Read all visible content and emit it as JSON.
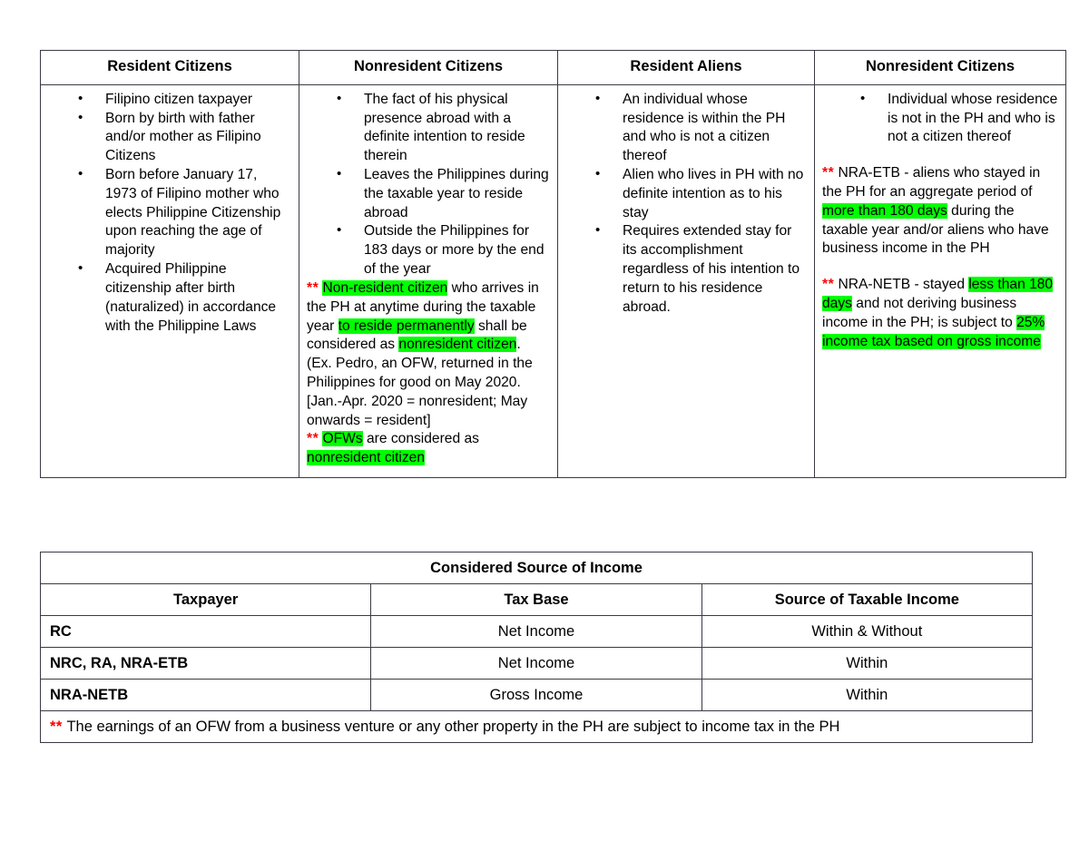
{
  "classification_table": {
    "columns": [
      {
        "header": "Resident Citizens",
        "bullets": [
          "Filipino citizen taxpayer",
          "Born by birth with father and/or mother as Filipino Citizens",
          "Born before January 17, 1973 of Filipino mother who elects Philippine Citizenship upon reaching the age of majority",
          "Acquired Philippine citizenship after birth (naturalized) in accordance with the Philippine Laws"
        ],
        "notes": []
      },
      {
        "header": "Nonresident Citizens",
        "bullets": [
          "The fact of his physical presence abroad with a definite intention to reside therein",
          "Leaves the Philippines during the taxable year to reside abroad",
          "Outside the Philippines for 183 days or more by the end of the year"
        ],
        "notes": [
          {
            "asterisk": "**",
            "segments": [
              {
                "text": "Non-resident citizen",
                "highlight": true
              },
              {
                "text": " who arrives in the PH at anytime during the taxable year ",
                "highlight": false
              },
              {
                "text": "to reside permanently",
                "highlight": true
              },
              {
                "text": " shall be considered as ",
                "highlight": false
              },
              {
                "text": "nonresident citizen",
                "highlight": true
              },
              {
                "text": ".",
                "highlight": false
              }
            ]
          },
          {
            "asterisk": "",
            "segments": [
              {
                "text": "(Ex. Pedro, an OFW, returned in the Philippines for good on May 2020. [Jan.-Apr. 2020 = nonresident; May onwards = resident]",
                "highlight": false
              }
            ]
          },
          {
            "asterisk": "**",
            "segments": [
              {
                "text": "OFWs",
                "highlight": true
              },
              {
                "text": " are considered as ",
                "highlight": false
              },
              {
                "text": "nonresident citizen",
                "highlight": true
              }
            ]
          }
        ]
      },
      {
        "header": "Resident Aliens",
        "bullets": [
          "An individual whose residence is within the PH and who is not a citizen thereof",
          "Alien who lives in PH with no definite intention as to his stay",
          "Requires extended stay for its accomplishment regardless of his intention to return to his residence abroad."
        ],
        "notes": []
      },
      {
        "header": "Nonresident Citizens",
        "bullets": [
          "Individual whose residence is not in the PH and who is not a citizen thereof"
        ],
        "notes": [
          {
            "asterisk": "**",
            "spaced": true,
            "segments": [
              {
                "text": "NRA-ETB - aliens who stayed in the PH for an aggregate period of ",
                "highlight": false
              },
              {
                "text": "more than 180 days",
                "highlight": true
              },
              {
                "text": " during the taxable year and/or aliens who have business income in the PH",
                "highlight": false
              }
            ]
          },
          {
            "asterisk": "**",
            "spaced": true,
            "segments": [
              {
                "text": "NRA-NETB - stayed ",
                "highlight": false
              },
              {
                "text": "less than 180 days",
                "highlight": true
              },
              {
                "text": " and not deriving business income in the PH; is subject to ",
                "highlight": false
              },
              {
                "text": "25% income tax based on gross income",
                "highlight": true
              }
            ]
          }
        ]
      }
    ]
  },
  "source_table": {
    "title": "Considered Source of Income",
    "headers": [
      "Taxpayer",
      "Tax Base",
      "Source of Taxable Income"
    ],
    "rows": [
      {
        "taxpayer": "RC",
        "tax_base": "Net Income",
        "source": "Within & Without"
      },
      {
        "taxpayer": "NRC, RA, NRA-ETB",
        "tax_base": "Net Income",
        "source": "Within"
      },
      {
        "taxpayer": "NRA-NETB",
        "tax_base": "Gross Income",
        "source": "Within"
      }
    ],
    "footnote": {
      "asterisk": "**",
      "text": "The earnings of an OFW from a business venture or any other property in the PH are subject to income tax in the PH"
    }
  },
  "colors": {
    "highlight": "#00ff00",
    "asterisk": "#ff0000",
    "border": "#3a3a45",
    "text": "#000000",
    "background": "#ffffff"
  }
}
